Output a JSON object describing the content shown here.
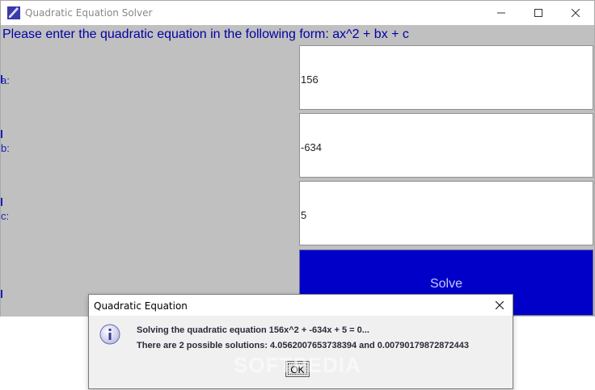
{
  "window": {
    "title": "Quadratic Equation Solver"
  },
  "form": {
    "instruction": "Please enter the quadratic equation in the following form: ax^2 + bx + c",
    "fields": [
      {
        "label": "a:",
        "value": "156"
      },
      {
        "label": "b:",
        "value": "-634"
      },
      {
        "label": "c:",
        "value": "5"
      }
    ],
    "solve_label": "Solve"
  },
  "dialog": {
    "title": "Quadratic Equation",
    "line1": "Solving the quadratic equation 156x^2 + -634x + 5 = 0...",
    "line2": "There are 2 possible solutions: 4.0562007653738394 and 0.00790179872872443",
    "ok_label": "OK"
  },
  "watermark": "SOFTPEDIA",
  "colors": {
    "panel_bg": "#c0c0c0",
    "label_text": "#0000a6",
    "solve_bg": "#0000c8",
    "solve_text": "#c8c8ff"
  },
  "icons": {
    "app": "pencil-icon",
    "dialog": "info-icon"
  }
}
